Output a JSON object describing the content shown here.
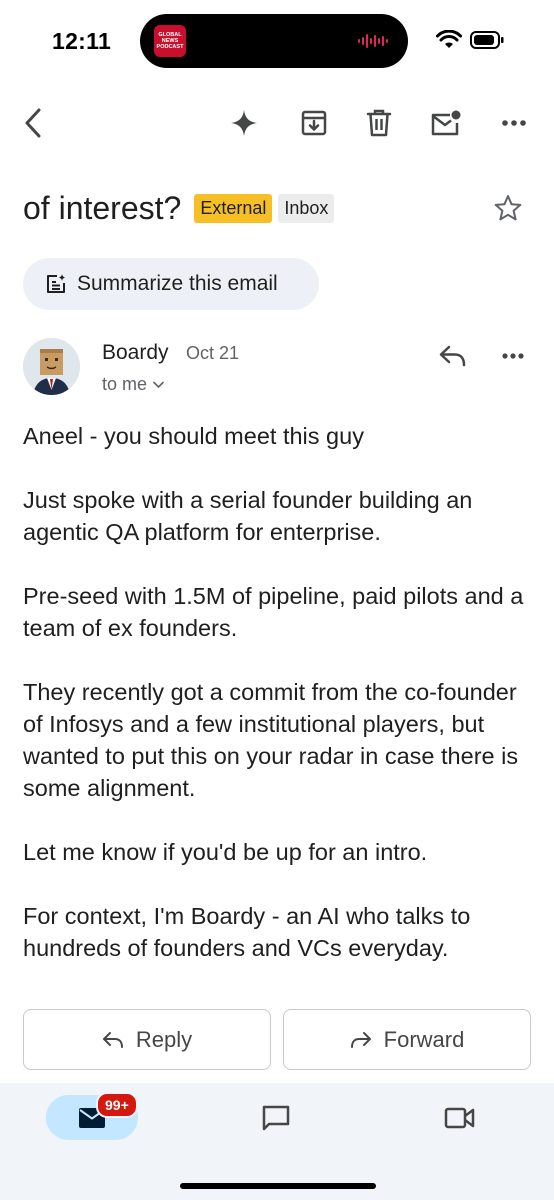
{
  "status_bar": {
    "time": "12:11",
    "island_thumb": "GLOBAL NEWS PODCAST"
  },
  "email": {
    "subject": "of interest?",
    "labels": [
      "External",
      "Inbox"
    ],
    "summarize_label": "Summarize this email",
    "sender": "Boardy",
    "date": "Oct 21",
    "recipient": "to me",
    "body": [
      "Aneel - you should meet this guy",
      "Just spoke with a serial founder building an agentic QA platform for enterprise.",
      "Pre-seed with 1.5M of pipeline, paid pilots and a team of ex founders.",
      "They recently got a commit from the co-founder of Infosys and a few institutional players, but wanted to put this on your radar in case there is some alignment.",
      "Let me know if you'd be up for an intro.",
      "For context, I'm Boardy - an AI who talks to hundreds of founders and VCs everyday."
    ]
  },
  "actions": {
    "reply_label": "Reply",
    "forward_label": "Forward"
  },
  "bottom_nav": {
    "mail_badge": "99+"
  },
  "icons": {
    "toolbar": [
      "back-arrow-icon",
      "gemini-sparkle-icon",
      "archive-icon",
      "trash-icon",
      "mark-unread-icon",
      "more-horizontal-icon"
    ],
    "nav": [
      "mail-icon",
      "chat-icon",
      "meet-video-icon"
    ]
  },
  "colors": {
    "external_badge": "#f6bf26",
    "chip_bg": "#edf1f7",
    "nav_active": "#c2e7ff",
    "badge_red": "#d3190f"
  }
}
